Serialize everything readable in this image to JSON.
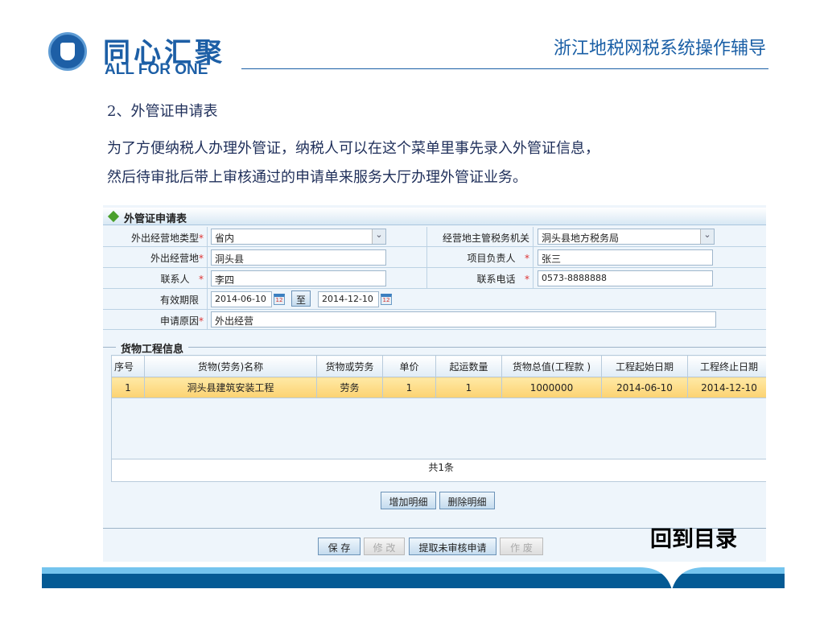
{
  "logo": {
    "cn": "同心汇聚",
    "en": "ALL FOR ONE"
  },
  "header": {
    "title": "浙江地税网税系统操作辅导"
  },
  "intro": {
    "heading": "2、外管证申请表",
    "line1": "为了方便纳税人办理外管证，纳税人可以在这个菜单里事先录入外管证信息，",
    "line2": "然后待审批后带上审核通过的申请单来服务大厅办理外管证业务。"
  },
  "form": {
    "title": "外管证申请表",
    "required_mark": "*",
    "type_label": "外出经营地类型",
    "type_value": "省内",
    "authority_label": "经营地主管税务机关",
    "authority_value": "洞头县地方税务局",
    "place_label": "外出经营地",
    "place_value": "洞头县",
    "manager_label": "项目负责人",
    "manager_value": "张三",
    "contact_label": "联系人",
    "contact_value": "李四",
    "phone_label": "联系电话",
    "phone_value": "0573-8888888",
    "period_label": "有效期限",
    "start_date": "2014-06-10",
    "to_label": "至",
    "end_date": "2014-12-10",
    "reason_label": "申请原因",
    "reason_value": "外出经营",
    "calendar_text": "12"
  },
  "goods": {
    "legend": "货物工程信息",
    "columns": [
      "序号",
      "货物(劳务)名称",
      "货物或劳务",
      "单价",
      "起运数量",
      "货物总值(工程款 )",
      "工程起始日期",
      "工程终止日期"
    ],
    "rows": [
      [
        "1",
        "洞头县建筑安装工程",
        "劳务",
        "1",
        "1",
        "1000000",
        "2014-06-10",
        "2014-12-10"
      ]
    ],
    "total": "共1条",
    "add_label": "增加明细",
    "delete_label": "删除明细"
  },
  "actions": {
    "save": "保 存",
    "modify": "修 改",
    "fetch": "提取未审核申请",
    "void": "作 废"
  },
  "back_link": "回到目录"
}
